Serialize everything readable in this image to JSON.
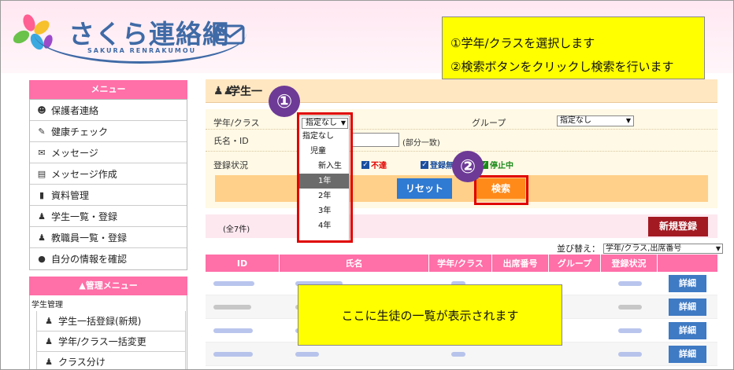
{
  "header": {
    "logo_text": "さくら連絡網",
    "logo_sub": "SAKURA RENRAKUMOU"
  },
  "callouts": {
    "top_line1": "①学年/クラスを選択します",
    "top_line2": "②検索ボタンをクリックし検索を行います",
    "bottom": "ここに生徒の一覧が表示されます",
    "marker1": "①",
    "marker2": "②"
  },
  "sidebar": {
    "menu_title": "メニュー",
    "items": [
      {
        "label": "保護者連絡",
        "icon": "person-icon"
      },
      {
        "label": "健康チェック",
        "icon": "pen-icon"
      },
      {
        "label": "メッセージ",
        "icon": "mail-icon"
      },
      {
        "label": "メッセージ作成",
        "icon": "edit-icon"
      },
      {
        "label": "資料管理",
        "icon": "book-icon"
      },
      {
        "label": "学生一覧・登録",
        "icon": "users-icon"
      },
      {
        "label": "教職員一覧・登録",
        "icon": "users-icon"
      },
      {
        "label": "自分の情報を確認",
        "icon": "chat-icon"
      }
    ],
    "admin_title": "▲管理メニュー",
    "admin_group": "学生管理",
    "admin_items": [
      {
        "label": "学生一括登録(新規)"
      },
      {
        "label": "学年/クラス一括変更"
      },
      {
        "label": "クラス分け"
      }
    ]
  },
  "main": {
    "title": "学生一",
    "form": {
      "grade_label": "学年/クラス",
      "grade_value": "指定なし",
      "group_label": "グループ",
      "group_value": "指定なし",
      "name_label": "氏名・ID",
      "name_hint": "(部分一致)",
      "status_label": "登録状況",
      "status_unsent": "不達",
      "status_unregistered": "登録無",
      "status_stopped": "停止中",
      "reset_label": "リセット",
      "search_label": "検索"
    },
    "dropdown_options": [
      "指定なし",
      "児童",
      "新入生",
      "1年",
      "2年",
      "3年",
      "4年"
    ],
    "dropdown_highlight": "1年",
    "count": "(全7件)",
    "new_button": "新規登録",
    "sort_label": "並び替え：",
    "sort_value": "学年/クラス,出席番号",
    "table_headers": [
      "ID",
      "氏名",
      "学年/クラス",
      "出席番号",
      "グループ",
      "登録状況",
      ""
    ],
    "detail_label": "詳細"
  },
  "colors": {
    "accent_pink": "#ff6fa8",
    "brand_blue": "#3f6aa6",
    "callout_yellow": "#ffff00",
    "marker_purple": "#6d3a96",
    "highlight_red": "#e00000"
  }
}
